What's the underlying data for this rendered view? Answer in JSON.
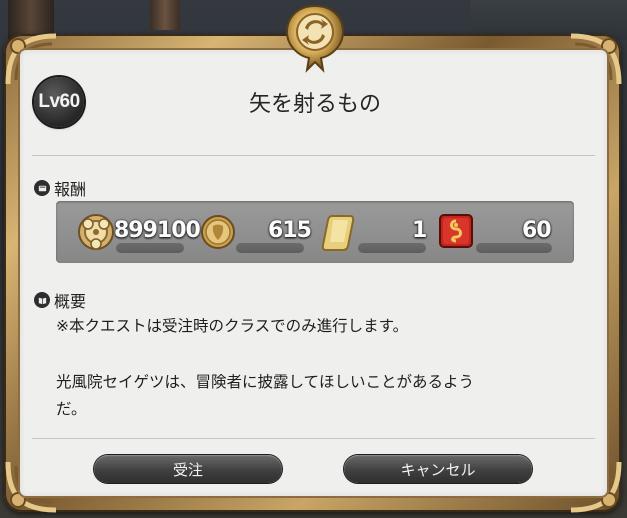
{
  "dialog": {
    "level_label": "Lv60",
    "quest_title": "矢を射るもの"
  },
  "rewards": {
    "header": "報酬",
    "items": [
      {
        "icon": "gil-icon",
        "value": "899100"
      },
      {
        "icon": "gold-coin-icon",
        "value": "615"
      },
      {
        "icon": "gold-bar-icon",
        "value": "1"
      },
      {
        "icon": "red-token-icon",
        "value": "60"
      }
    ]
  },
  "summary": {
    "header": "概要",
    "line1": "※本クエストは受注時のクラスでのみ進行します。",
    "line2": "光風院セイゲツは、冒険者に披露してほしいことがあるよう",
    "line3": "だ。"
  },
  "buttons": {
    "accept": "受注",
    "cancel": "キャンセル"
  },
  "colors": {
    "frame_gold": "#c9a566",
    "panel_bg": "#efefed",
    "reward_bar": "#8f8f8f",
    "button_dark": "#404040"
  }
}
